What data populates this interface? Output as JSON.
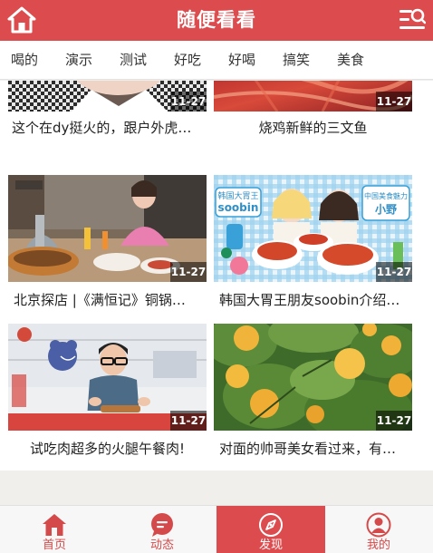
{
  "header": {
    "title": "随便看看",
    "home_icon": "home-icon",
    "menu_icon": "list-search-icon"
  },
  "tabs": [
    "喝的",
    "演示",
    "测试",
    "好吃",
    "好喝",
    "搞笑",
    "美食"
  ],
  "feed": {
    "rows": [
      [
        {
          "title": "这个在dy挺火的，跟户外虎…",
          "date": "11-27"
        },
        {
          "title": "烧鸡新鲜的三文鱼",
          "date": "11-27"
        }
      ],
      [
        {
          "title": "北京探店 |《满恒记》铜锅…",
          "date": "11-27"
        },
        {
          "title": "韩国大胃王朋友soobin介绍…",
          "date": "11-27",
          "thumb_text": [
            "韩国大胃王",
            "soobin",
            "中国美食魅力",
            "小野"
          ]
        }
      ],
      [
        {
          "title": "试吃肉超多的火腿午餐肉!",
          "date": "11-27"
        },
        {
          "title": "对面的帅哥美女看过来，有…",
          "date": "11-27"
        }
      ]
    ]
  },
  "bottom_nav": [
    {
      "label": "首页",
      "icon": "home-icon",
      "active": false
    },
    {
      "label": "动态",
      "icon": "chat-bubble-icon",
      "active": false
    },
    {
      "label": "发现",
      "icon": "compass-icon",
      "active": true
    },
    {
      "label": "我的",
      "icon": "user-icon",
      "active": false
    }
  ],
  "colors": {
    "brand": "#dc4b4d",
    "background": "#f1efec"
  }
}
